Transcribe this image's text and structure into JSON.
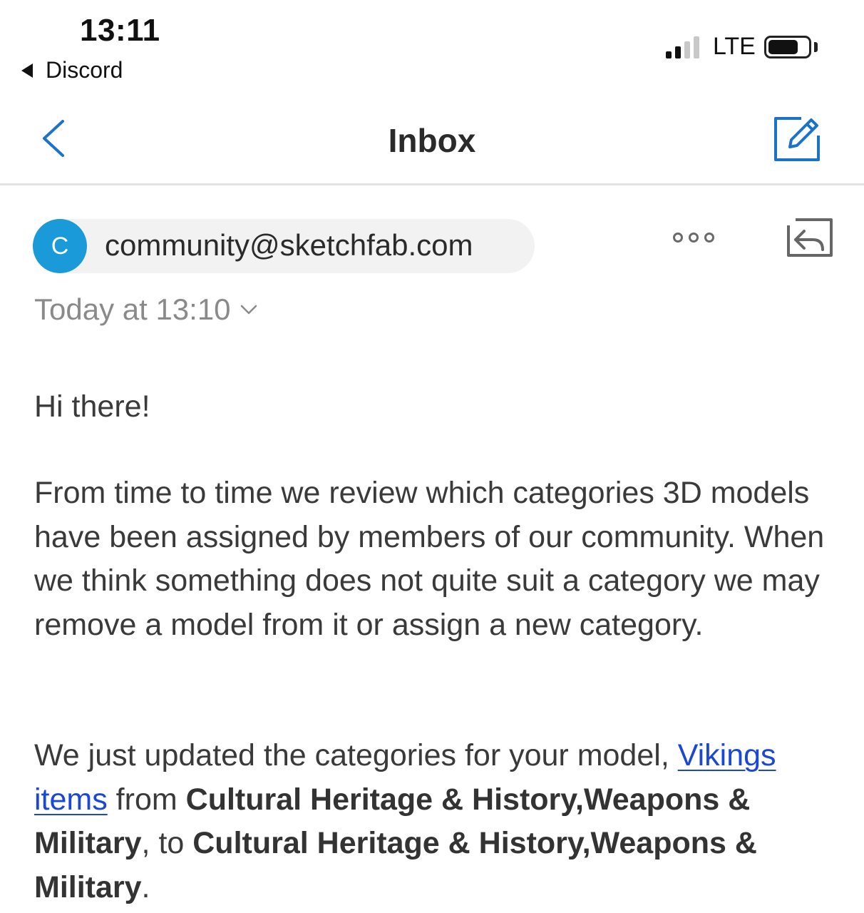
{
  "status_bar": {
    "time": "13:11",
    "back_app": "Discord",
    "network": "LTE",
    "signal_bars_active": 2,
    "signal_bars_total": 4,
    "battery_level": 0.75
  },
  "nav": {
    "title": "Inbox",
    "back_icon": "chevron-left-icon",
    "compose_icon": "compose-icon",
    "accent_color": "#1a73c8"
  },
  "message": {
    "sender_initial": "C",
    "sender_email": "community@sketchfab.com",
    "avatar_color": "#1a9ad8",
    "date": "Today at 13:10",
    "more_icon": "more-options-icon",
    "reply_icon": "reply-icon",
    "body": {
      "greeting": "Hi there!",
      "para1": "From time to time we review which categories 3D models have been assigned by members of our community. When we think something does not quite suit a category we may remove a model from it or assign a new category.",
      "para2_prefix": "We just updated the categories for your model, ",
      "model_link": "Vikings items",
      "para2_from": " from ",
      "old_categories": "Cultural Heritage & History,Weapons & Military",
      "para2_to": ", to ",
      "new_categories": "Cultural Heritage & History,Weapons & Military",
      "para2_end": "."
    }
  }
}
